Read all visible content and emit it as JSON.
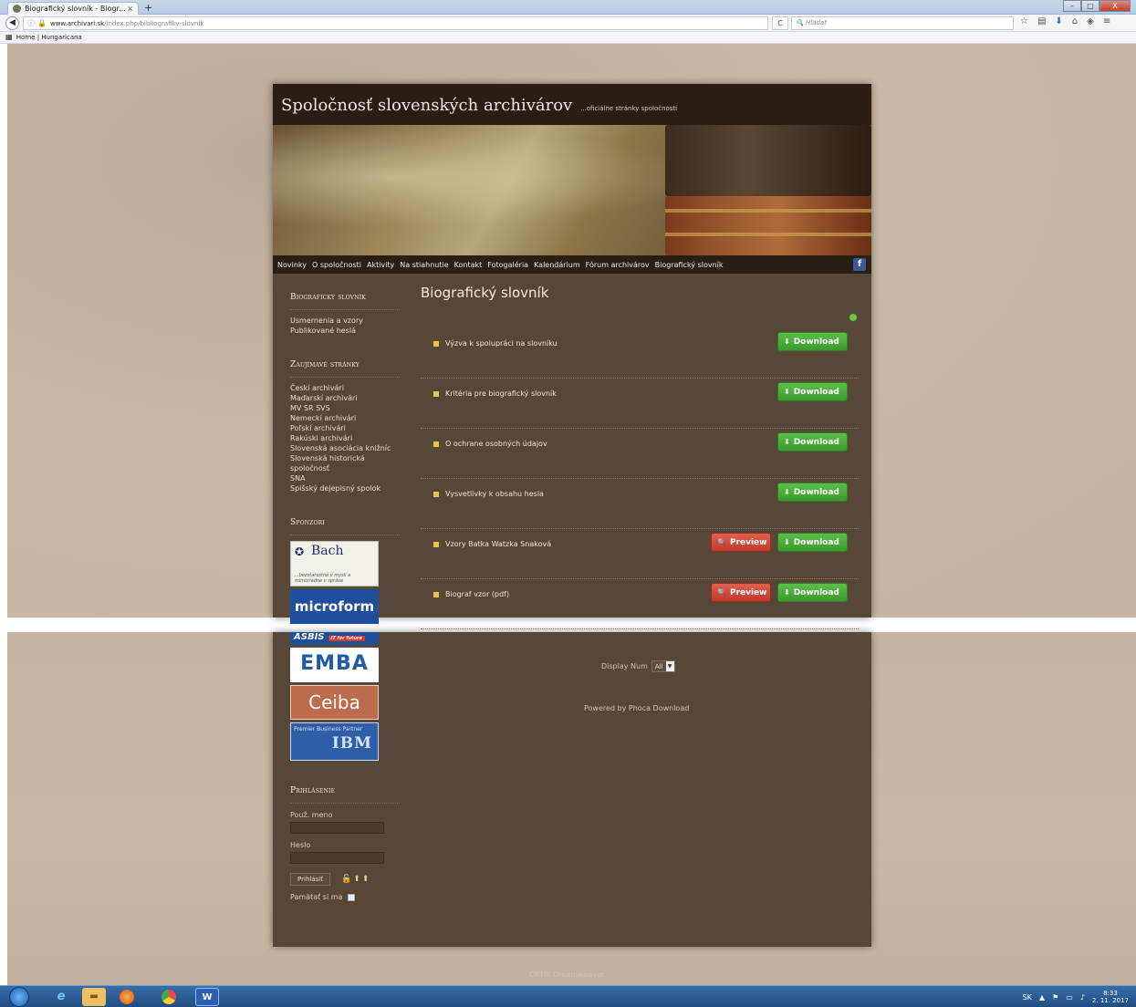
{
  "browser": {
    "tab_title": "Biografický slovník - Biogr...",
    "tab_close": "×",
    "new_tab": "+",
    "url_host": "www.archivari.sk",
    "url_path": "/index.php/bibliografiky-slovnik",
    "search_placeholder": "Hľadať",
    "bookmark": "Home | Hungaricana",
    "window_controls": [
      "–",
      "□",
      "X"
    ]
  },
  "site": {
    "title": "Spoločnosť slovenských archivárov",
    "tagline": "...oficiálne stránky spoločnosti",
    "menu": [
      "Novinky",
      "O spoločnosti",
      "Aktivity",
      "Na stiahnutie",
      "Kontakt",
      "Fotogaléria",
      "Kalendárium",
      "Fórum archivárov",
      "Biografický slovník"
    ],
    "facebook_icon": "f"
  },
  "sidebar": {
    "section1_heading": "Biografický slovník",
    "section1_links": [
      "Usmernenia a vzory",
      "Publikované heslá"
    ],
    "section2_heading": "Zaujímavé stránky",
    "section2_links": [
      "Českí archivári",
      "Maďarskí archivári",
      "MV SR SVS",
      "Nemeckí archivári",
      "Poľskí archivári",
      "Rakúski archivári",
      "Slovenská asociácia knižníc",
      "Slovenská historická spoločnosť",
      "SNA",
      "Spišský dejepisný spolok"
    ],
    "section3_heading": "Sponzori",
    "sponsors": {
      "bach": "Bach",
      "bach_sub": "...bezstarostné v mysli a mimoriadne v správe",
      "microform": "microform",
      "asbis": "ASBIS",
      "asbis_tag": "IT for future",
      "emba": "EMBA",
      "ceiba": "Ceiba",
      "ibm_text": "Premier Business Partner",
      "ibm_logo": "IBM"
    },
    "login_heading": "Prihlásenie",
    "username_label": "Použ. meno",
    "password_label": "Heslo",
    "login_button": "Prihlásiť",
    "remember_label": "Pamätať si ma"
  },
  "content": {
    "title": "Biografický slovník",
    "download_label": "Download",
    "preview_label": "Preview",
    "files": [
      {
        "name": "Výzva k spolupráci na slovníku",
        "preview": false
      },
      {
        "name": "Kritéria pre biografický slovník",
        "preview": false
      },
      {
        "name": "O ochrane osobných údajov",
        "preview": false
      },
      {
        "name": "Vysvetlivky k obsahu hesla",
        "preview": false
      },
      {
        "name": "Vzory Batka Watzka Snaková",
        "preview": true
      },
      {
        "name": "Biograf vzor (pdf)",
        "preview": true
      }
    ],
    "display_num_label": "Display Num",
    "display_num_value": "All",
    "powered_by": "Powered by Phoca Download"
  },
  "footer": {
    "text": "ORTIS Dreamweaver"
  },
  "taskbar": {
    "language": "SK",
    "time": "8:33",
    "date": "2. 11. 2017"
  }
}
